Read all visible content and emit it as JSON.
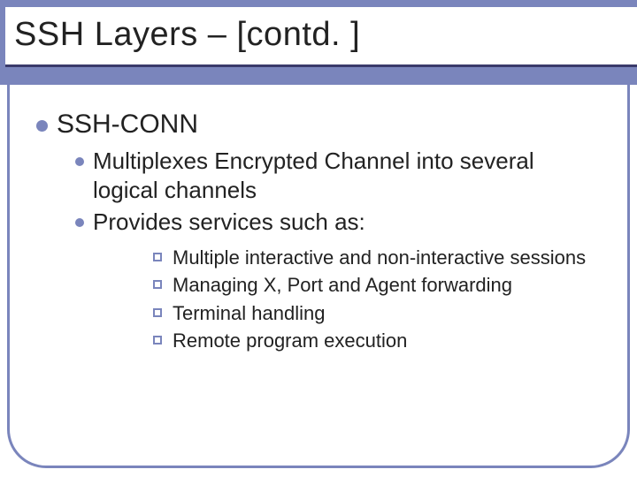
{
  "title": "SSH Layers – [contd. ]",
  "level1": {
    "heading": "SSH-CONN"
  },
  "level2": [
    {
      "text": "Multiplexes Encrypted Channel into several logical channels"
    },
    {
      "text": "Provides services such as:"
    }
  ],
  "level3": [
    {
      "text": "Multiple interactive and non-interactive sessions"
    },
    {
      "text": "Managing X, Port and Agent forwarding"
    },
    {
      "text": "Terminal handling"
    },
    {
      "text": "Remote program execution"
    }
  ],
  "colors": {
    "accent": "#7a85bc",
    "rule": "#3a3a6a"
  }
}
